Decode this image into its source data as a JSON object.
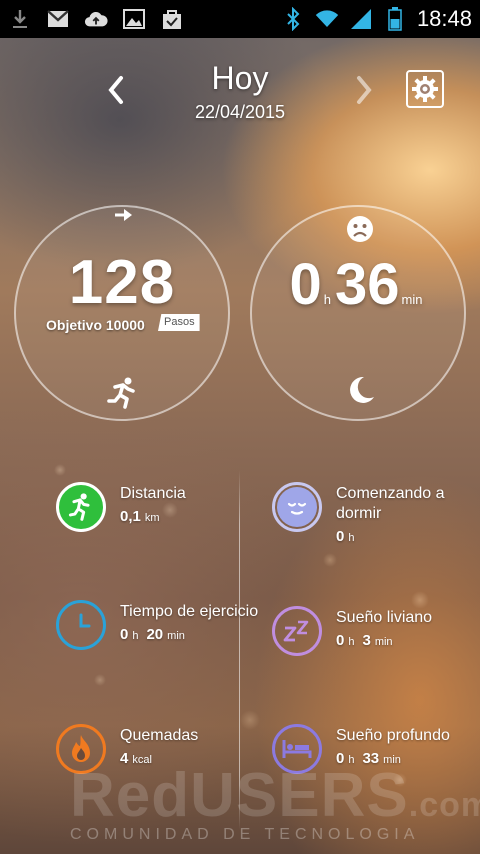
{
  "status_bar": {
    "time": "18:48",
    "left_icons": [
      "download-icon",
      "gmail-icon",
      "cloud-upload-icon",
      "image-icon",
      "shopping-bag-icon"
    ],
    "right_icons": [
      "bluetooth-icon",
      "wifi-icon",
      "signal-icon",
      "battery-icon"
    ]
  },
  "header": {
    "title": "Hoy",
    "date": "22/04/2015"
  },
  "steps": {
    "value": "128",
    "goal_label": "Objetivo 10000",
    "unit": "Pasos"
  },
  "sleep": {
    "hours": "0",
    "hours_unit": "h",
    "minutes": "36",
    "minutes_unit": "min"
  },
  "stats": {
    "distance": {
      "label": "Distancia",
      "value": "0,1",
      "unit": "km"
    },
    "falling_asleep": {
      "label": "Comenzando a dormir",
      "value": "0",
      "unit": "h"
    },
    "exercise_time": {
      "label": "Tiempo de ejercicio",
      "hours": "0",
      "hours_unit": "h",
      "minutes": "20",
      "minutes_unit": "min"
    },
    "light_sleep": {
      "label": "Sueño liviano",
      "hours": "0",
      "hours_unit": "h",
      "minutes": "3",
      "minutes_unit": "min"
    },
    "burned": {
      "label": "Quemadas",
      "value": "4",
      "unit": "kcal"
    },
    "deep_sleep": {
      "label": "Sueño profundo",
      "hours": "0",
      "hours_unit": "h",
      "minutes": "33",
      "minutes_unit": "min"
    }
  },
  "watermark": {
    "brand": "RedUSERS",
    "suffix": ".com",
    "tagline": "COMUNIDAD DE TECNOLOGIA"
  },
  "colors": {
    "green": "#2fbf3c",
    "blue": "#2aa2d8",
    "orange": "#f07a20",
    "lavender": "#9fa6e8",
    "purple": "#c08ee0",
    "violet": "#8c7ae0",
    "status_blue": "#33b5e5"
  }
}
